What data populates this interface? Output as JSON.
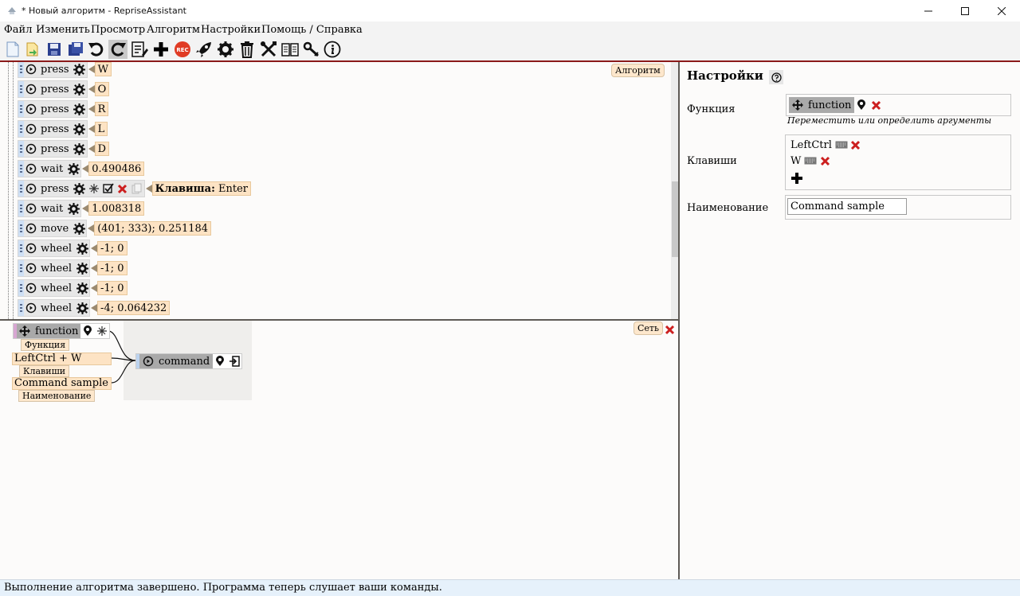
{
  "window": {
    "title": "* Новый алгоритм - RepriseAssistant",
    "controls": [
      "minimize-icon",
      "maximize-icon",
      "close-icon"
    ]
  },
  "menu": [
    "Файл",
    "Изменить",
    "Просмотр",
    "Алгоритм",
    "Настройки",
    "Помощь / Справка"
  ],
  "toolbar": {
    "icons": [
      "new-file-icon",
      "open-file-icon",
      "save-icon",
      "save-as-icon",
      "undo-icon",
      "redo-icon",
      "edit-list-icon",
      "add-icon",
      "record-icon",
      "run-icon",
      "settings-icon",
      "delete-icon",
      "tools-icon",
      "book-icon",
      "link-icon",
      "info-icon"
    ],
    "record_label": "REC"
  },
  "algorithm": {
    "tab_label": "Алгоритм",
    "commands": [
      {
        "name": "press",
        "value": "W"
      },
      {
        "name": "press",
        "value": "O"
      },
      {
        "name": "press",
        "value": "R"
      },
      {
        "name": "press",
        "value": "L"
      },
      {
        "name": "press",
        "value": "D"
      },
      {
        "name": "wait",
        "value": "0.490486"
      },
      {
        "name": "press",
        "value_label": "Клавиша:",
        "value": "Enter",
        "expanded": true
      },
      {
        "name": "wait",
        "value": "1.008318"
      },
      {
        "name": "move",
        "value": "(401; 333); 0.251184"
      },
      {
        "name": "wheel",
        "value": "-1; 0"
      },
      {
        "name": "wheel",
        "value": "-1; 0"
      },
      {
        "name": "wheel",
        "value": "-1; 0"
      },
      {
        "name": "wheel",
        "value": "-4; 0.064232"
      }
    ]
  },
  "network": {
    "tab_label": "Сеть",
    "function_node": {
      "label": "function",
      "caption": "Функция"
    },
    "keys_node": {
      "value": "LeftCtrl + W",
      "caption": "Клавиши"
    },
    "name_node": {
      "value": "Command sample",
      "caption": "Наименование"
    },
    "command_node": {
      "label": "command"
    }
  },
  "settings": {
    "title": "Настройки",
    "function_label": "Функция",
    "function_value": "function",
    "function_hint": "Переместить или определить аргументы",
    "keys_label": "Клавиши",
    "keys": [
      "LeftCtrl",
      "W"
    ],
    "name_label": "Наименование",
    "name_value": "Command sample"
  },
  "status": "Выполнение алгоритма завершено. Программа теперь слушает ваши команды.",
  "colors": {
    "accent_red": "#8b1a1a",
    "delete_red": "#cc1f1f",
    "value_bg": "#fde3c4",
    "grip_blue": "#cfe0f5"
  }
}
